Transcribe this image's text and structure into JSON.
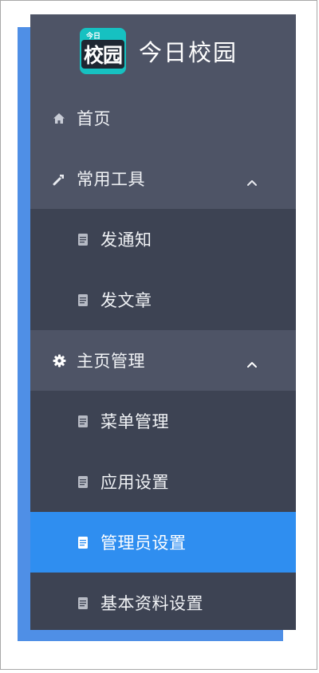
{
  "app": {
    "logo_small_text": "今日",
    "logo_big_text": "校园",
    "title": "今日校园"
  },
  "menu": {
    "home": {
      "label": "首页",
      "icon": "home-icon"
    },
    "tools": {
      "label": "常用工具",
      "icon": "wrench-icon",
      "expanded": true,
      "items": [
        {
          "label": "发通知",
          "icon": "document-icon"
        },
        {
          "label": "发文章",
          "icon": "document-icon"
        }
      ]
    },
    "homepage_management": {
      "label": "主页管理",
      "icon": "gear-icon",
      "expanded": true,
      "items": [
        {
          "label": "菜单管理",
          "icon": "document-icon"
        },
        {
          "label": "应用设置",
          "icon": "document-icon"
        },
        {
          "label": "管理员设置",
          "icon": "document-icon",
          "active": true
        },
        {
          "label": "基本资料设置",
          "icon": "document-icon"
        }
      ]
    }
  },
  "colors": {
    "sidebar_dark": "#3d4353",
    "sidebar_light": "#4e5466",
    "active_blue": "#2f8ef0",
    "frame_shadow_blue": "#4f8fe6",
    "logo_teal": "#16c1c1"
  }
}
